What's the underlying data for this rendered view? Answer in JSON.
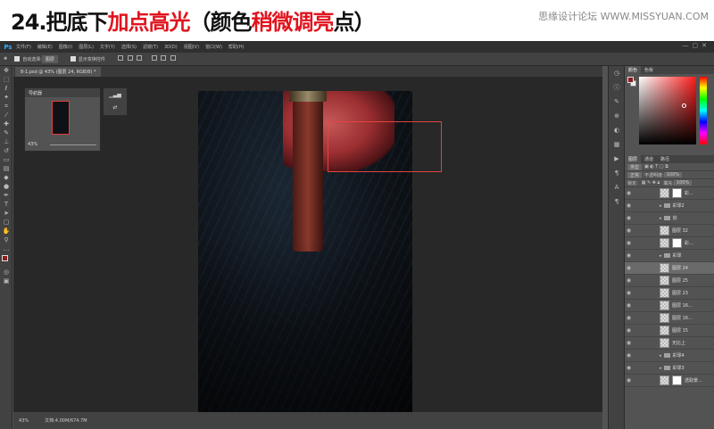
{
  "header": {
    "title_prefix": "24.把底下",
    "title_red1": "加点高光",
    "title_mid": "（颜色",
    "title_red2": "稍微调亮",
    "title_suffix": "点）",
    "watermark": "思缘设计论坛 WWW.MISSYUAN.COM",
    "accent_color": "#e0141e"
  },
  "menubar": {
    "logo": "Ps",
    "items": [
      "文件(F)",
      "编辑(E)",
      "图像(I)",
      "图层(L)",
      "文字(Y)",
      "选择(S)",
      "滤镜(T)",
      "3D(D)",
      "视图(V)",
      "窗口(W)",
      "帮助(H)"
    ],
    "window_controls": "—▢✕"
  },
  "optbar": {
    "auto_select_label": "自动选择:",
    "auto_select_value": "图层",
    "show_transform_label": "显示变换控件"
  },
  "document": {
    "tab_title": "8-1.psd @ 43% (图层 24, RGB/8) *"
  },
  "navigator": {
    "title": "导航器",
    "zoom": "43%"
  },
  "status": {
    "zoom": "43%",
    "doc_size": "文档:4.00M/674.7M"
  },
  "color_panel": {
    "tabs": [
      "颜色",
      "色板"
    ],
    "fg_color": "#8c1e1e",
    "bg_color": "#eeeeee"
  },
  "layers_panel": {
    "tabs": [
      "图层",
      "通道",
      "路径"
    ],
    "kind_label": "类型",
    "blend_mode": "正常",
    "opacity_label": "不透明度:",
    "opacity_value": "100%",
    "lock_label": "锁定:",
    "fill_label": "填充:",
    "fill_value": "100%",
    "layers": [
      {
        "name": "彩...",
        "type": "layer-mask",
        "active": false
      },
      {
        "name": "彩球2",
        "type": "folder",
        "active": false
      },
      {
        "name": "剑",
        "type": "folder",
        "active": false
      },
      {
        "name": "图层 32",
        "type": "layer",
        "active": false
      },
      {
        "name": "彩...",
        "type": "layer-mask",
        "active": false
      },
      {
        "name": "彩球",
        "type": "folder",
        "active": false
      },
      {
        "name": "图层 24",
        "type": "layer",
        "active": true
      },
      {
        "name": "图层 25",
        "type": "layer",
        "active": false
      },
      {
        "name": "图层 23",
        "type": "layer",
        "active": false
      },
      {
        "name": "图层 16...",
        "type": "layer",
        "active": false
      },
      {
        "name": "图层 16...",
        "type": "layer",
        "active": false
      },
      {
        "name": "图层 15",
        "type": "layer",
        "active": false
      },
      {
        "name": "无比上",
        "type": "layer",
        "active": false
      },
      {
        "name": "彩球4",
        "type": "folder",
        "active": false
      },
      {
        "name": "彩球3",
        "type": "folder",
        "active": false
      },
      {
        "name": "选取景...",
        "type": "layer-mask",
        "active": false
      }
    ]
  }
}
